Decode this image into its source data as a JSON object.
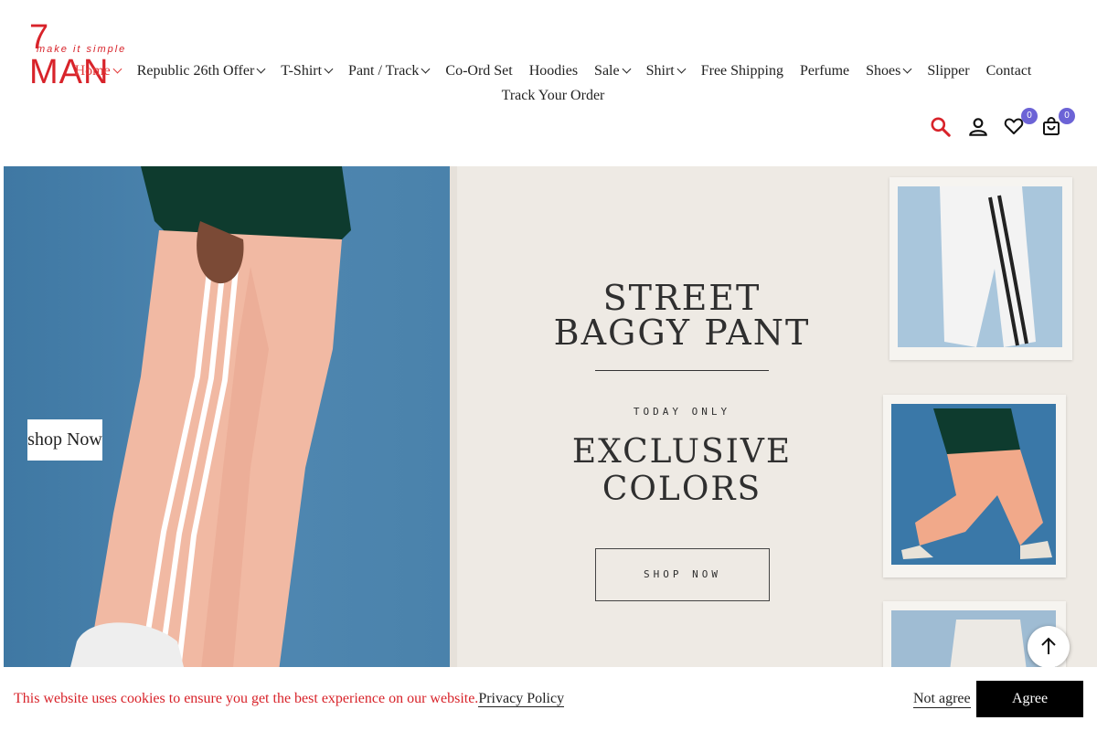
{
  "brand": {
    "logo_text": "7 MAN",
    "tagline": "make it simple",
    "color": "#d8232a"
  },
  "nav": {
    "row1": [
      {
        "label": "Home",
        "dropdown": true,
        "active": true
      },
      {
        "label": "Republic 26th Offer",
        "dropdown": true
      },
      {
        "label": "T-Shirt",
        "dropdown": true
      },
      {
        "label": "Pant / Track",
        "dropdown": true
      },
      {
        "label": "Co-Ord Set",
        "dropdown": false
      },
      {
        "label": "Hoodies",
        "dropdown": false
      },
      {
        "label": "Sale",
        "dropdown": true
      },
      {
        "label": "Shirt",
        "dropdown": true
      },
      {
        "label": "Free Shipping",
        "dropdown": false
      },
      {
        "label": "Perfume",
        "dropdown": false
      },
      {
        "label": "Shoes",
        "dropdown": true
      },
      {
        "label": "Slipper",
        "dropdown": false
      },
      {
        "label": "Contact",
        "dropdown": false
      }
    ],
    "row2": [
      {
        "label": "Track Your Order",
        "dropdown": false
      }
    ]
  },
  "header_icons": {
    "search": "search-icon",
    "account": "user-icon",
    "wishlist": {
      "icon": "heart-icon",
      "count": "0"
    },
    "cart": {
      "icon": "bag-icon",
      "count": "0"
    },
    "accent": "#6c63d6"
  },
  "hero": {
    "button_label": "shop Now",
    "banner": {
      "title_line1": "STREET",
      "title_line2": "BAGGY PANT",
      "subtitle": "TODAY ONLY",
      "headline_line1": "EXCLUSIVE",
      "headline_line2": "COLORS",
      "cta": "SHOP NOW"
    }
  },
  "cookie": {
    "message": "This website uses cookies to ensure you get the best experience on our website.",
    "link": "Privacy Policy",
    "decline": "Not agree",
    "accept": "Agree"
  }
}
